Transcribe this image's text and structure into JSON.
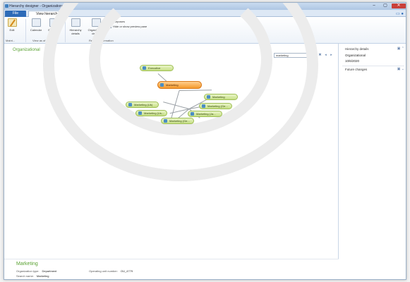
{
  "window": {
    "title": "Hierarchy designer - Organizational (D)"
  },
  "tabs": {
    "file": "File",
    "view_hierarchy": "View hierarchy"
  },
  "ribbon": {
    "buttons": {
      "edit": "Edit",
      "calendar": "Calendar",
      "effective_date": "Effective date*",
      "hierarchy_details": "Hierarchy details",
      "organization_details": "Organization details"
    },
    "small_commands": {
      "purposes": "Purposes",
      "hide_show_preview": "Hide or show preview pane"
    },
    "groups": {
      "maintain": "Maint...",
      "view_as_of_date": "View as of date",
      "related_information": "Related information"
    }
  },
  "canvas": {
    "title": "Organizational",
    "find_label": "Find:",
    "find_value": "marketing"
  },
  "nodes": {
    "executive": "Executive",
    "center": "Marketing",
    "child_1": "Marketing",
    "child_2": "Marketing (Ge...",
    "child_3": "Marketing (Ja...",
    "child_4": "Marketing (Uk)",
    "child_5": "Marketing (Us...",
    "child_6": "Marketing (Ge..."
  },
  "info": {
    "title": "Marketing",
    "org_type_label": "Organization type:",
    "org_type_value": "Department",
    "search_name_label": "Search name:",
    "search_name_value": "Marketing",
    "op_unit_label": "Operating unit number:",
    "op_unit_value": "OU_4779"
  },
  "side_panel": {
    "hierarchy_details_title": "Hierarchy details",
    "hierarchy_name": "Organizational",
    "hierarchy_date": "10/6/2020",
    "future_changes_title": "Future changes"
  },
  "colors": {
    "accent_green": "#5aa232",
    "node_green": "#c6df86",
    "node_orange": "#f49a2c",
    "file_tab_blue": "#2d6bb8"
  }
}
